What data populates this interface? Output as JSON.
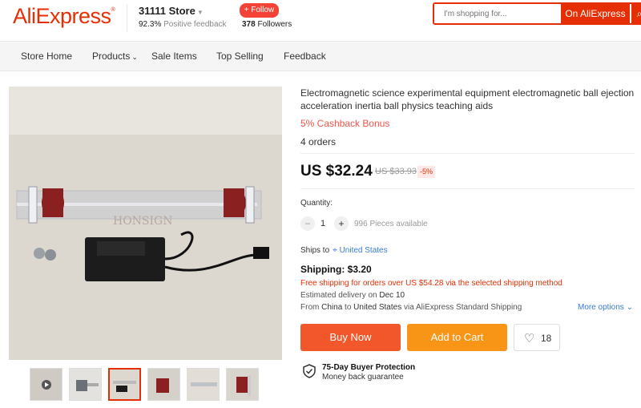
{
  "header": {
    "logo": "AliExpress",
    "store_name": "31111 Store",
    "positive_pct": "92.3%",
    "positive_label": "Positive feedback",
    "follow_label": "+ Follow",
    "followers_count": "378",
    "followers_label": "Followers",
    "search_placeholder": "I'm shopping for...",
    "search_scope": "On AliExpress"
  },
  "nav": {
    "items": [
      {
        "label": "Store Home"
      },
      {
        "label": "Products"
      },
      {
        "label": "Sale Items"
      },
      {
        "label": "Top Selling"
      },
      {
        "label": "Feedback"
      }
    ]
  },
  "product": {
    "title": "Electromagnetic science experimental equipment electromagnetic ball ejection acceleration inertia ball physics teaching aids",
    "cashback": "5% Cashback Bonus",
    "orders": "4 orders",
    "price": "US $32.24",
    "old_price": "US $33.93",
    "discount": "-5%",
    "quantity_label": "Quantity:",
    "quantity_value": "1",
    "available": "996 Pieces available",
    "ships_to_label": "Ships to",
    "ships_to_country": "United States",
    "shipping_title": "Shipping: $3.20",
    "free_shipping_note": "Free shipping for orders over US $54.28 via the selected shipping method",
    "estimated_label": "Estimated delivery on",
    "estimated_date": "Dec 10",
    "from_label": "From",
    "from_country": "China",
    "to_label": "to",
    "to_country": "United States",
    "via_text": "via AliExpress Standard Shipping",
    "more_options": "More options",
    "buy_now": "Buy Now",
    "add_to_cart": "Add to Cart",
    "wishlist_count": "18",
    "protection_title": "75-Day Buyer Protection",
    "protection_sub": "Money back guarantee",
    "watermark": "HONSIGN"
  },
  "colors": {
    "brand": "#e62e04",
    "buy": "#f2572b",
    "cart": "#f89416",
    "link": "#3a7bd5"
  }
}
